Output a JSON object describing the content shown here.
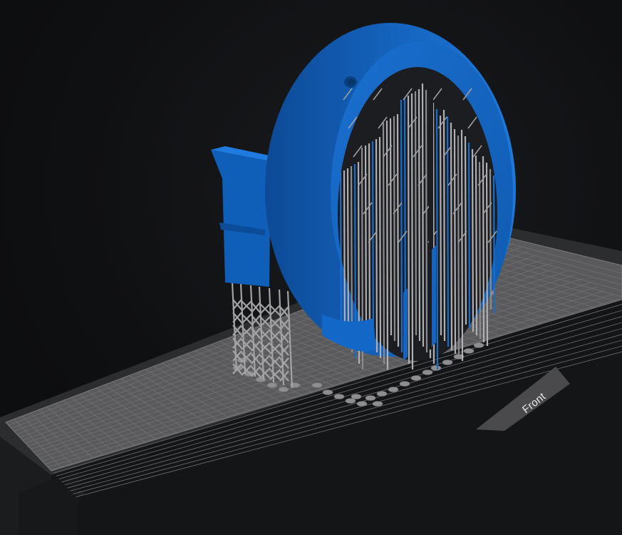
{
  "viewport": {
    "background": "#0e0f11",
    "build_plate_color": "#5a5a5c",
    "plate_grid_color": "#707072",
    "model_color": "#1565c0",
    "support_color": "#9a9a9a"
  },
  "plate": {
    "front_label": "Front"
  },
  "model": {
    "name": "model-ring-with-supports"
  }
}
